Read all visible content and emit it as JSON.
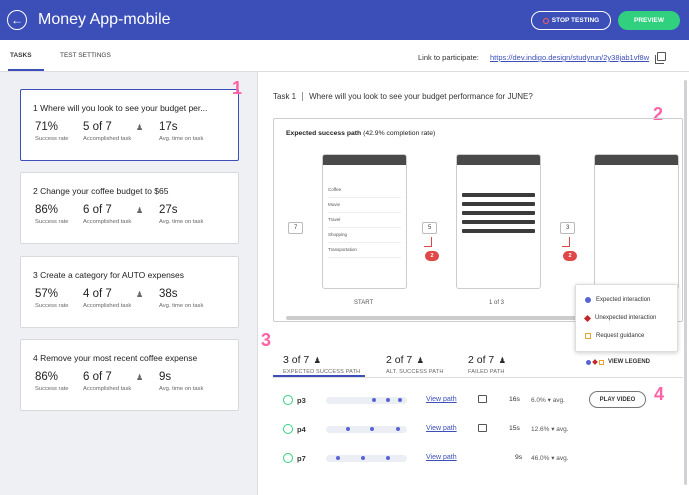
{
  "header": {
    "title": "Money App-mobile",
    "stop_label": "STOP TESTING",
    "preview_label": "PREVIEW"
  },
  "tabs": [
    {
      "label": "TASKS"
    },
    {
      "label": "TEST SETTINGS"
    }
  ],
  "participate": {
    "label": "Link to participate:",
    "url": "https://dev.indigo.design/studyrun/2y38jab1vf8w"
  },
  "tasks": [
    {
      "title": "1  Where will you look to see your budget per...",
      "success": "71%",
      "accomplished": "5 of 7",
      "time": "17s"
    },
    {
      "title": "2  Change your coffee budget to $65",
      "success": "86%",
      "accomplished": "6 of 7",
      "time": "27s"
    },
    {
      "title": "3  Create a category for AUTO expenses",
      "success": "57%",
      "accomplished": "4 of 7",
      "time": "38s"
    },
    {
      "title": "4  Remove your most recent coffee expense",
      "success": "86%",
      "accomplished": "6 of 7",
      "time": "9s"
    }
  ],
  "stat_labels": {
    "success": "Success rate",
    "accomplished": "Accomplished task",
    "time": "Avg. time on task"
  },
  "badges": [
    "1",
    "2",
    "3",
    "4"
  ],
  "detail": {
    "task_num": "Task 1",
    "task_title": "Where will you look to see your budget performance for JUNE?",
    "path_title": "Expected success path",
    "path_rate": "(42.9% completion rate)",
    "step_tags": [
      "7",
      "5",
      "3"
    ],
    "red_tags": [
      "2",
      "2"
    ],
    "captions": [
      "START",
      "1 of 3"
    ],
    "phone_rows": [
      "Coffee",
      "Movie",
      "Travel",
      "Shopping",
      "Transportation"
    ]
  },
  "legend": {
    "expected": "Expected interaction",
    "unexpected": "Unexpected interaction",
    "guidance": "Request guidance",
    "view_label": "VIEW LEGEND"
  },
  "summary": [
    {
      "value": "3 of 7",
      "label": "EXPECTED SUCCESS PATH"
    },
    {
      "value": "2 of 7",
      "label": "ALT. SUCCESS PATH"
    },
    {
      "value": "2 of 7",
      "label": "FAILED PATH"
    }
  ],
  "participants": [
    {
      "name": "p3",
      "view": "View path",
      "time": "16s",
      "avg": "6.0% ▾ avg."
    },
    {
      "name": "p4",
      "view": "View path",
      "time": "15s",
      "avg": "12.6% ▾ avg."
    },
    {
      "name": "p7",
      "view": "View path",
      "time": "9s",
      "avg": "46.0% ▾ avg."
    }
  ],
  "play_label": "PLAY VIDEO",
  "colors": {
    "primary": "#3c4fb8",
    "success": "#31d07e",
    "badge": "#ff62a6",
    "danger": "#e04848"
  }
}
